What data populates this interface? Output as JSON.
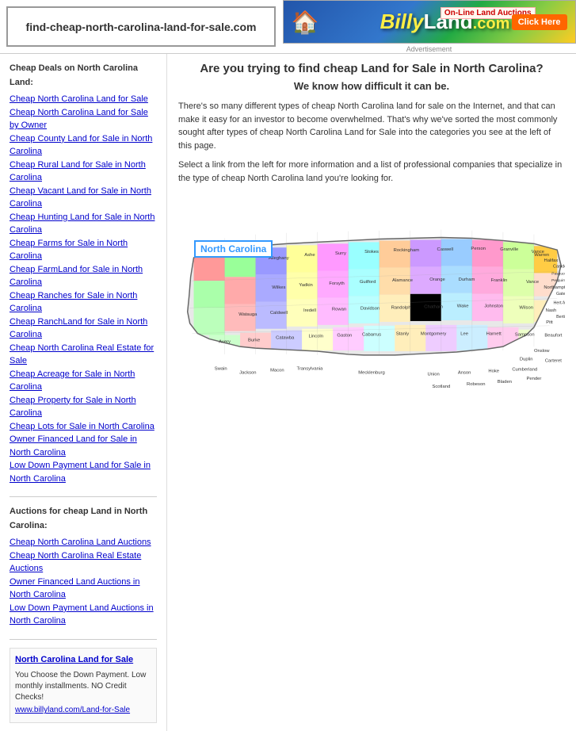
{
  "header": {
    "url": "find-cheap-north-carolina-land-for-sale.com",
    "ad_text": "BillyLand.com",
    "ad_label": "Advertisement",
    "ad_online": "On-Line Land Auctions",
    "ad_click": "Click Here"
  },
  "sidebar": {
    "section1_title": "Cheap Deals on North Carolina Land:",
    "section1_links": [
      "Cheap North Carolina Land for Sale",
      "Cheap North Carolina Land for Sale by Owner",
      "Cheap County Land for Sale in North Carolina",
      "Cheap Rural Land for Sale in North Carolina",
      "Cheap Vacant Land for Sale in North Carolina",
      "Cheap Hunting Land for Sale in North Carolina",
      "Cheap Farms for Sale in North Carolina",
      "Cheap FarmLand for Sale in North Carolina",
      "Cheap Ranches for Sale in North Carolina",
      "Cheap RanchLand for Sale in North Carolina",
      "Cheap North Carolina Real Estate for Sale",
      "Cheap Acreage for Sale in North Carolina",
      "Cheap Property for Sale in North Carolina",
      "Cheap Lots for Sale in North Carolina",
      "Owner Financed Land for Sale in North Carolina",
      "Low Down Payment Land for Sale in North Carolina"
    ],
    "section2_title": "Auctions for cheap Land in North Carolina:",
    "section2_links": [
      "Cheap North Carolina Land Auctions",
      "Cheap North Carolina Real Estate Auctions",
      "Owner Financed Land Auctions in North Carolina",
      "Low Down Payment Land Auctions in North Carolina"
    ],
    "promo_title": "North Carolina Land for Sale",
    "promo_text": "You Choose the Down Payment. Low monthly installments. NO Credit Checks!",
    "promo_url": "www.billyland.com/Land-for-Sale"
  },
  "content": {
    "heading1": "Are you trying to find cheap Land for Sale in North Carolina?",
    "heading2": "We know how difficult it can be.",
    "para1": "There's so many different types of cheap North Carolina land for sale on the Internet, and that can make it easy for an investor to become overwhelmed. That's why we've sorted the most commonly sought after types of cheap North Carolina Land for Sale into the categories you see at the left of this page.",
    "para2": "Select a link from the left for more information and a list of professional companies that specialize in the type of cheap North Carolina land you're looking for.",
    "map_label": "North Carolina"
  },
  "colors": {
    "link": "#0000cc",
    "heading": "#333333",
    "accent": "#3399ff"
  }
}
